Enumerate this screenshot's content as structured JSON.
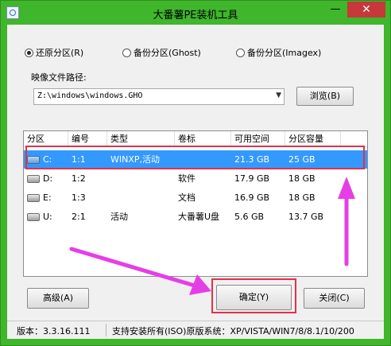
{
  "window": {
    "title": "大番薯PE装机工具",
    "minimize_glyph": "—",
    "close_glyph": "✕"
  },
  "modes": [
    {
      "label": "还原分区(R)",
      "selected": true
    },
    {
      "label": "备份分区(Ghost)",
      "selected": false
    },
    {
      "label": "备份分区(Imagex)",
      "selected": false
    }
  ],
  "image_path": {
    "label": "映像文件路径:",
    "value": "Z:\\windows\\windows.GHO",
    "browse_label": "浏览(B)"
  },
  "partition_table": {
    "columns": [
      "分区",
      "编号",
      "类型",
      "卷标",
      "可用空间",
      "分区容量"
    ],
    "rows": [
      {
        "drive": "C:",
        "number": "1:1",
        "type": "WINXP,活动",
        "label": "",
        "free": "21.3 GB",
        "size": "25 GB",
        "selected": true
      },
      {
        "drive": "D:",
        "number": "1:2",
        "type": "",
        "label": "软件",
        "free": "17.9 GB",
        "size": "18 GB",
        "selected": false
      },
      {
        "drive": "E:",
        "number": "1:3",
        "type": "",
        "label": "文档",
        "free": "16.9 GB",
        "size": "18 GB",
        "selected": false
      },
      {
        "drive": "U:",
        "number": "2:1",
        "type": "活动",
        "label": "大番薯U盘",
        "free": "5.6 GB",
        "size": "13.7 GB",
        "selected": false
      }
    ]
  },
  "buttons": {
    "advanced": "高级(A)",
    "ok": "确定(Y)",
    "close": "关闭(C)"
  },
  "status": {
    "version": "版本：3.3.16.111",
    "support": "支持安装所有(ISO)原版系统：XP/VISTA/WIN7/8/8.1/10/200"
  },
  "annotation_color": "#e2314a",
  "arrow_color": "#e63ee6",
  "title_bar_color": "#3fb62c",
  "selection_color": "#3399ff"
}
